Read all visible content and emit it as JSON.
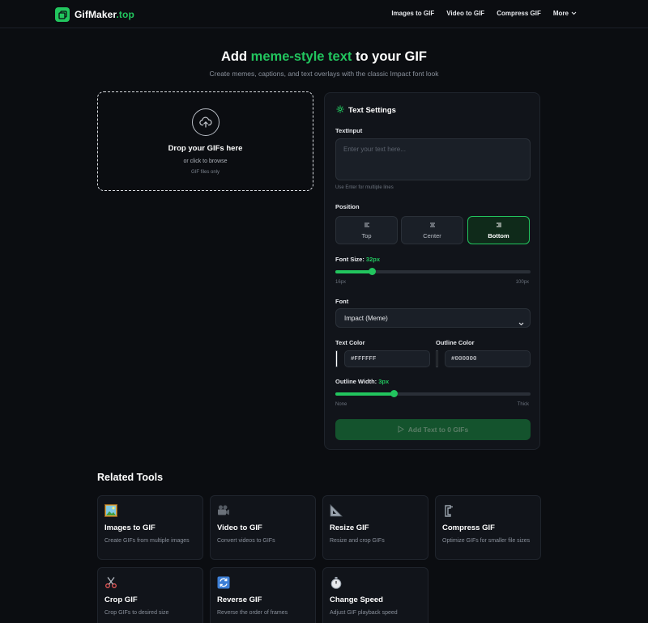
{
  "header": {
    "logo_main": "GifMaker",
    "logo_suffix": ".top",
    "nav": [
      "Images to GIF",
      "Video to GIF",
      "Compress GIF",
      "More"
    ]
  },
  "hero": {
    "title_before": "Add ",
    "title_accent": "meme-style text",
    "title_after": " to your GIF",
    "subtitle": "Create memes, captions, and text overlays with the classic Impact font look"
  },
  "dropzone": {
    "title": "Drop your GIFs here",
    "subtitle": "or click to browse",
    "note": "GIF files only",
    "icon": "upload-icon"
  },
  "settings": {
    "title": "Text Settings",
    "icon": "gear-icon",
    "text_label": "TextInput",
    "text_value": "",
    "text_placeholder": "Enter your text here...",
    "text_hint": "Use Enter for multiple lines",
    "position_label": "Position",
    "positions": [
      "Top",
      "Center",
      "Bottom"
    ],
    "position_selected": "Bottom",
    "font_size_label": "Font Size: ",
    "font_size_value": "32px",
    "font_size_level": 0.19,
    "font_size_min": "16px",
    "font_size_max": "100px",
    "font_label": "Font",
    "font_value": "Impact (Meme)",
    "text_color_label": "Text Color",
    "text_color_value": "#FFFFFF",
    "outline_color_label": "Outline Color",
    "outline_color_value": "#000000",
    "outline_width_label": "Outline Width: ",
    "outline_width_value": "3px",
    "outline_width_level": 0.3,
    "outline_min": "None",
    "outline_max": "Thick",
    "action_label": "Add Text to 0 GIFs"
  },
  "related": {
    "title": "Related Tools",
    "cards": [
      {
        "icon": "image-icon",
        "title": "Images to GIF",
        "desc": "Create GIFs from multiple images"
      },
      {
        "icon": "video-camera-icon",
        "title": "Video to GIF",
        "desc": "Convert videos to GIFs"
      },
      {
        "icon": "ruler-icon",
        "title": "Resize GIF",
        "desc": "Resize and crop GIFs"
      },
      {
        "icon": "clamp-icon",
        "title": "Compress GIF",
        "desc": "Optimize GIFs for smaller file sizes"
      },
      {
        "icon": "scissors-icon",
        "title": "Crop GIF",
        "desc": "Crop GIFs to desired size"
      },
      {
        "icon": "reverse-icon",
        "title": "Reverse GIF",
        "desc": "Reverse the order of frames"
      },
      {
        "icon": "stopwatch-icon",
        "title": "Change Speed",
        "desc": "Adjust GIF playback speed"
      }
    ]
  },
  "colors": {
    "accent": "#22c55e",
    "background": "#0b0d11",
    "panel": "#11141a"
  }
}
